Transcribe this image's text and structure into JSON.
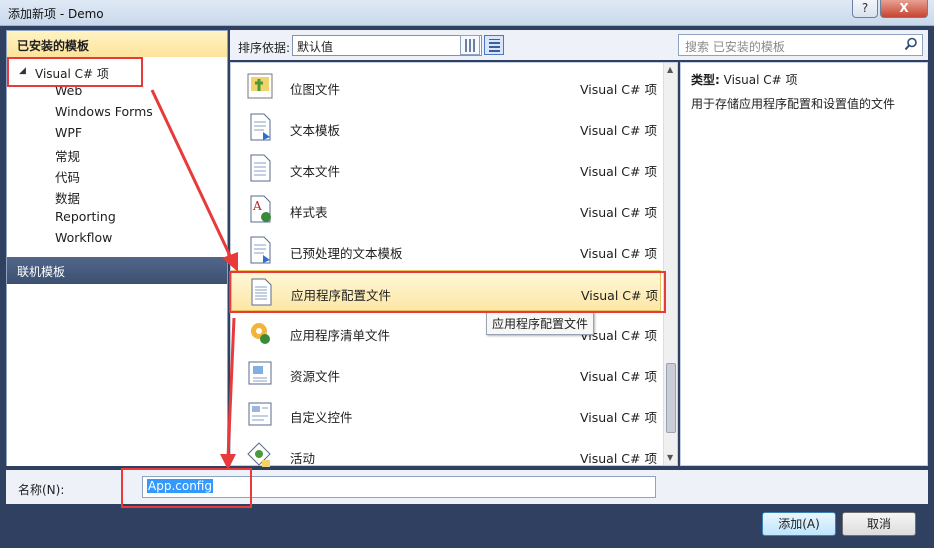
{
  "window": {
    "title": "添加新项 - Demo",
    "help": "?",
    "close": "X"
  },
  "sidebar": {
    "header": "已安装的模板",
    "root": "Visual C# 项",
    "items": [
      "Web",
      "Windows Forms",
      "WPF",
      "常规",
      "代码",
      "数据",
      "Reporting",
      "Workflow"
    ],
    "online": "联机模板"
  },
  "toolbar": {
    "sort_label": "排序依据:",
    "sort_value": "默认值",
    "search_placeholder": "搜索 已安装的模板"
  },
  "templates": [
    {
      "name": "位图文件",
      "type": "Visual C# 项",
      "icon": "bitmap-icon"
    },
    {
      "name": "文本模板",
      "type": "Visual C# 项",
      "icon": "text-template-icon"
    },
    {
      "name": "文本文件",
      "type": "Visual C# 项",
      "icon": "text-file-icon"
    },
    {
      "name": "样式表",
      "type": "Visual C# 项",
      "icon": "stylesheet-icon"
    },
    {
      "name": "已预处理的文本模板",
      "type": "Visual C# 项",
      "icon": "preprocessed-template-icon"
    },
    {
      "name": "应用程序配置文件",
      "type": "Visual C# 项",
      "icon": "config-file-icon",
      "selected": true
    },
    {
      "name": "应用程序清单文件",
      "type": "Visual C# 项",
      "icon": "manifest-icon"
    },
    {
      "name": "资源文件",
      "type": "Visual C# 项",
      "icon": "resource-file-icon"
    },
    {
      "name": "自定义控件",
      "type": "Visual C# 项",
      "icon": "custom-control-icon"
    },
    {
      "name": "活动",
      "type": "Visual C# 项",
      "icon": "activity-icon"
    }
  ],
  "tooltip": "应用程序配置文件",
  "details": {
    "type_label": "类型:",
    "type_value": "Visual C# 项",
    "description": "用于存储应用程序配置和设置值的文件"
  },
  "bottom": {
    "name_label": "名称(N):",
    "name_value": "App.config"
  },
  "buttons": {
    "add": "添加(A)",
    "cancel": "取消"
  },
  "colors": {
    "annotation": "#e83a3a",
    "selection": "#fde7a6",
    "header_accent": "#fde39a"
  }
}
